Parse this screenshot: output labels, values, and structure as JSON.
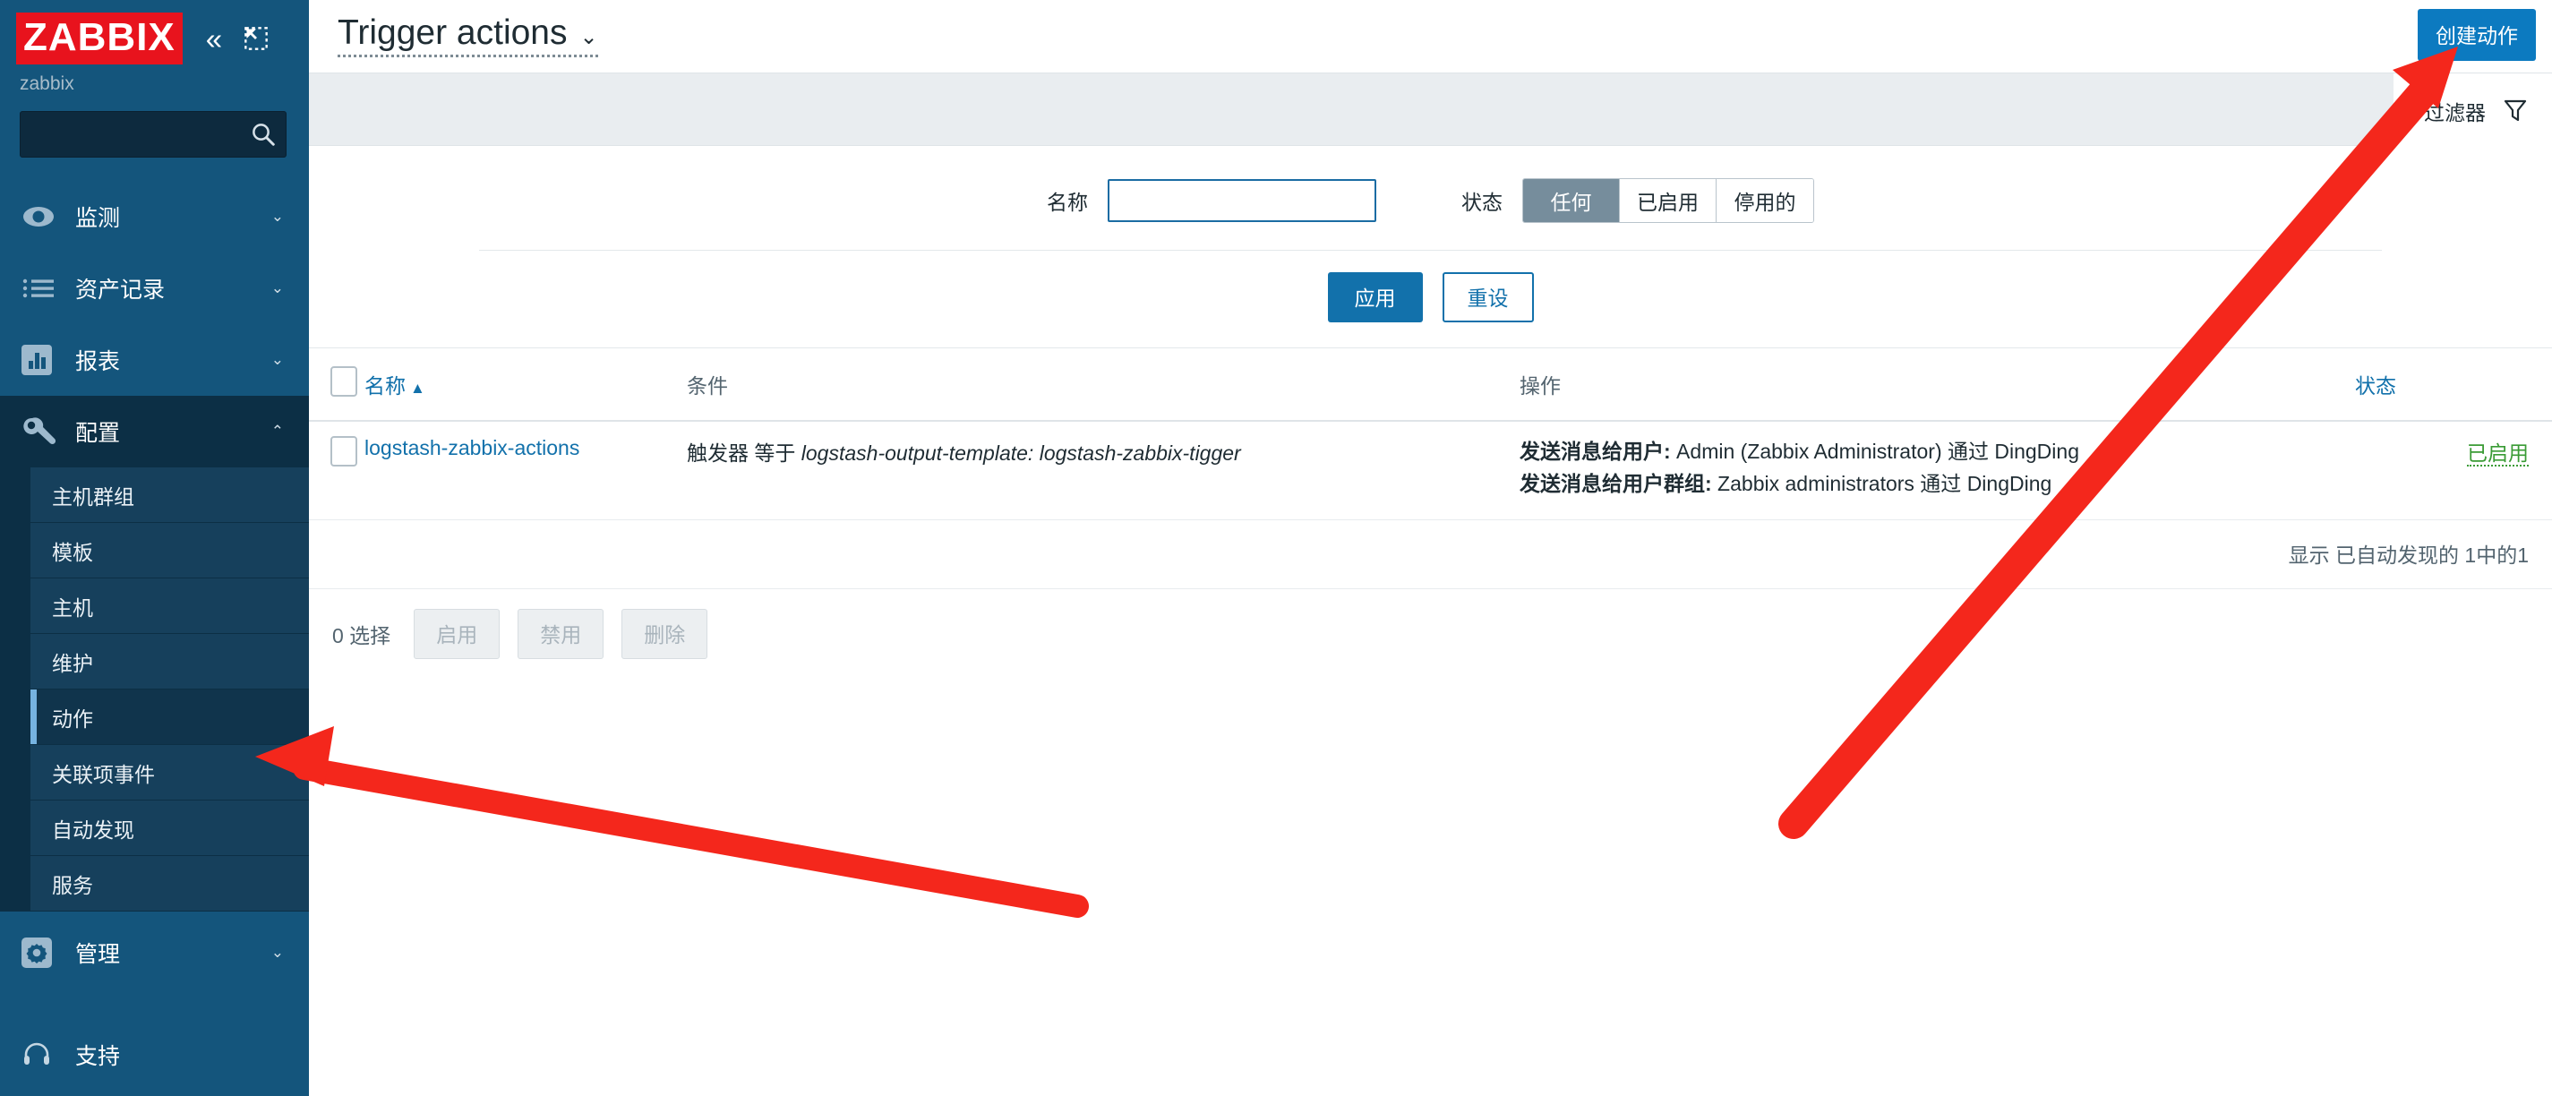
{
  "sidebar": {
    "logo_text": "ZABBIX",
    "collapse_icon": "double-chevron-left-icon",
    "compact_icon": "compact-view-icon",
    "username": "zabbix",
    "search": {
      "value": "",
      "placeholder": "",
      "icon": "search-icon"
    },
    "items": [
      {
        "label": "监测",
        "icon": "eye-icon",
        "chevron": "⌄",
        "expanded": false
      },
      {
        "label": "资产记录",
        "icon": "list-icon",
        "chevron": "⌄",
        "expanded": false
      },
      {
        "label": "报表",
        "icon": "bar-chart-icon",
        "chevron": "⌄",
        "expanded": false
      },
      {
        "label": "配置",
        "icon": "wrench-icon",
        "chevron": "⌃",
        "expanded": true
      }
    ],
    "submenu": [
      {
        "label": "主机群组",
        "selected": false
      },
      {
        "label": "模板",
        "selected": false
      },
      {
        "label": "主机",
        "selected": false
      },
      {
        "label": "维护",
        "selected": false
      },
      {
        "label": "动作",
        "selected": true
      },
      {
        "label": "关联项事件",
        "selected": false
      },
      {
        "label": "自动发现",
        "selected": false
      },
      {
        "label": "服务",
        "selected": false
      }
    ],
    "bottom_items": [
      {
        "label": "管理",
        "icon": "gear-icon",
        "chevron": "⌄"
      },
      {
        "label": "支持",
        "icon": "headset-icon",
        "chevron": ""
      }
    ]
  },
  "header": {
    "title": "Trigger actions",
    "title_chevron": "⌄",
    "create_button": "创建动作"
  },
  "filter": {
    "tab_label": "过滤器",
    "funnel_icon": "funnel-icon",
    "name_label": "名称",
    "name_value": "",
    "name_placeholder": "",
    "status_label": "状态",
    "status_options": [
      {
        "label": "任何",
        "active": true
      },
      {
        "label": "已启用",
        "active": false
      },
      {
        "label": "停用的",
        "active": false
      }
    ],
    "apply_label": "应用",
    "reset_label": "重设"
  },
  "table": {
    "columns": [
      {
        "label": "名称",
        "sort": "▲",
        "is_link": true
      },
      {
        "label": "条件",
        "sort": "",
        "is_link": false
      },
      {
        "label": "操作",
        "sort": "",
        "is_link": false
      },
      {
        "label": "状态",
        "sort": "",
        "is_link": true
      }
    ],
    "rows": [
      {
        "name": "logstash-zabbix-actions",
        "condition_prefix": "触发器 等于 ",
        "condition_value": "logstash-output-template: logstash-zabbix-tigger",
        "operations": [
          {
            "label": "发送消息给用户:",
            "value": " Admin (Zabbix Administrator) 通过 DingDing"
          },
          {
            "label": "发送消息给用户群组:",
            "value": " Zabbix administrators 通过 DingDing"
          }
        ],
        "status": "已启用"
      }
    ],
    "footer_text": "显示 已自动发现的 1中的1"
  },
  "bulk": {
    "selected_count_text": "0 选择",
    "buttons": [
      {
        "label": "启用",
        "disabled": true
      },
      {
        "label": "禁用",
        "disabled": true
      },
      {
        "label": "删除",
        "disabled": true
      }
    ]
  },
  "annotations": {
    "color": "#f4271c",
    "arrow_to_sidebar": "arrow-pointing-to-动作-menu",
    "arrow_to_create": "arrow-pointing-to-创建动作-button"
  },
  "colors": {
    "brand_red": "#e8131d",
    "sidebar_bg": "#14557c",
    "sidebar_open_bg": "#0c2f45",
    "accent_blue": "#1271ab",
    "create_blue": "#0c7ac0",
    "status_green": "#3a9b35",
    "annotation_red": "#f4271c"
  }
}
